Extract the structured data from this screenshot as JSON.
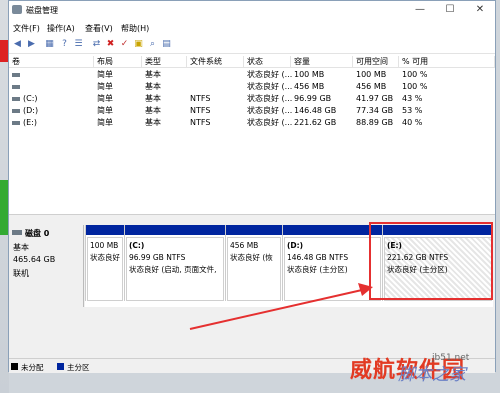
{
  "window": {
    "title": "磁盘管理"
  },
  "menu": [
    "文件(F)",
    "操作(A)",
    "查看(V)",
    "帮助(H)"
  ],
  "titlebar": {
    "minimize": "—",
    "maximize": "☐",
    "close": "✕"
  },
  "toolbar_icons": [
    "back-arrow",
    "forward-arrow",
    "grid-view",
    "help",
    "list-view",
    "connect",
    "delete",
    "check",
    "folder-add",
    "search",
    "properties"
  ],
  "volumes_header": [
    "卷",
    "布局",
    "类型",
    "文件系统",
    "状态",
    "容量",
    "可用空间",
    "% 可用"
  ],
  "volumes": [
    {
      "vol": "",
      "layout": "简单",
      "type": "基本",
      "fs": "",
      "status": "状态良好 (...",
      "capacity": "100 MB",
      "free": "100 MB",
      "pct": "100 %"
    },
    {
      "vol": "",
      "layout": "简单",
      "type": "基本",
      "fs": "",
      "status": "状态良好 (...",
      "capacity": "456 MB",
      "free": "456 MB",
      "pct": "100 %"
    },
    {
      "vol": "(C:)",
      "layout": "简单",
      "type": "基本",
      "fs": "NTFS",
      "status": "状态良好 (...",
      "capacity": "96.99 GB",
      "free": "41.97 GB",
      "pct": "43 %"
    },
    {
      "vol": "(D:)",
      "layout": "简单",
      "type": "基本",
      "fs": "NTFS",
      "status": "状态良好 (...",
      "capacity": "146.48 GB",
      "free": "77.34 GB",
      "pct": "53 %"
    },
    {
      "vol": "(E:)",
      "layout": "简单",
      "type": "基本",
      "fs": "NTFS",
      "status": "状态良好 (...",
      "capacity": "221.62 GB",
      "free": "88.89 GB",
      "pct": "40 %"
    }
  ],
  "disk": {
    "name": "磁盘 0",
    "type": "基本",
    "size": "465.64 GB",
    "state": "联机"
  },
  "partitions": [
    {
      "label": "",
      "size": "100 MB",
      "status": "状态良好"
    },
    {
      "label": "(C:)",
      "size": "96.99 GB NTFS",
      "status": "状态良好 (启动, 页面文件,"
    },
    {
      "label": "",
      "size": "456 MB",
      "status": "状态良好 (恢"
    },
    {
      "label": "(D:)",
      "size": "146.48 GB NTFS",
      "status": "状态良好 (主分区)"
    },
    {
      "label": "(E:)",
      "size": "221.62 GB NTFS",
      "status": "状态良好 (主分区)"
    }
  ],
  "legend": {
    "unallocated": "未分配",
    "primary": "主分区"
  },
  "colors": {
    "partition_header": "#00259f",
    "highlight": "#e53030",
    "unallocated": "#000000"
  },
  "watermark": {
    "main": "威航软件园",
    "site": "jb51.net",
    "secondary": "脚本之家"
  }
}
